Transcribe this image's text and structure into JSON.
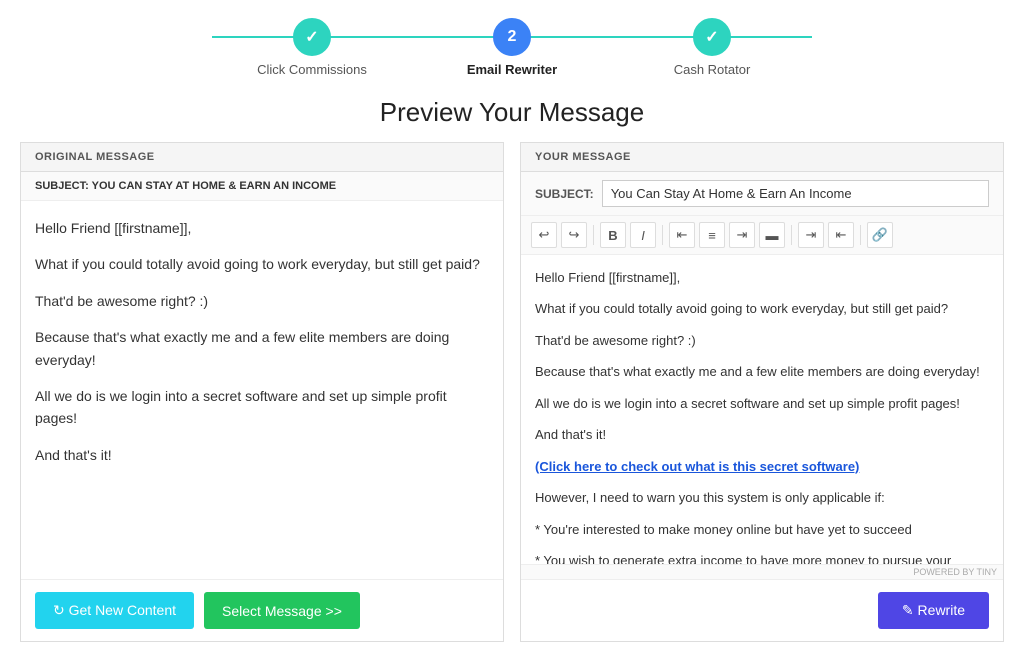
{
  "stepper": {
    "steps": [
      {
        "id": "click-commissions",
        "label": "Click Commissions",
        "state": "done",
        "icon": "✓",
        "number": ""
      },
      {
        "id": "email-rewriter",
        "label": "Email Rewriter",
        "state": "active",
        "icon": "",
        "number": "2"
      },
      {
        "id": "cash-rotator",
        "label": "Cash Rotator",
        "state": "done",
        "icon": "✓",
        "number": ""
      }
    ]
  },
  "page": {
    "title": "Preview Your Message"
  },
  "original_panel": {
    "header": "ORIGINAL MESSAGE",
    "subject_label": "SUBJECT: YOU CAN STAY AT HOME & EARN AN INCOME",
    "body_paragraphs": [
      "Hello Friend [[firstname]],",
      "What if you could totally avoid going to work everyday, but still get paid?",
      "That'd be awesome right? :)",
      "Because that's what exactly me and a few elite members are doing everyday!",
      "All we do is we login into a secret software and set up simple profit pages!",
      "And that's it!"
    ]
  },
  "your_panel": {
    "header": "YOUR MESSAGE",
    "subject_field_label": "SUBJECT:",
    "subject_value": "You Can Stay At Home & Earn An Income",
    "body_paragraphs": [
      "Hello Friend [[firstname]],",
      "What if you could totally avoid going to work everyday, but still get paid?",
      "That'd be awesome right? :)",
      "Because that's what exactly me and a few elite members are doing everyday!",
      "All we do is we login into a secret software and set up simple profit pages!",
      "And that's it!"
    ],
    "link_text": "(Click here to check out what is this secret software)",
    "extra_paragraphs": [
      "However, I need to warn you this system is only applicable if:",
      "* You're interested to make money online but have yet to succeed",
      "* You wish to generate extra income to have more money to pursue your passions."
    ],
    "powered_by": "POWERED BY TINY"
  },
  "buttons": {
    "get_new_content": "↻ Get New Content",
    "select_message": "Select Message >>",
    "rewrite": "✎ Rewrite"
  },
  "toolbar": {
    "undo": "↩",
    "redo": "↪",
    "bold": "B",
    "italic": "I",
    "align_left": "≡",
    "align_center": "≡",
    "align_right": "≡",
    "align_justify": "≡",
    "indent": "⇥",
    "outdent": "⇤",
    "link": "🔗"
  },
  "colors": {
    "cyan": "#22d3ee",
    "green": "#22c55e",
    "teal": "#2dd4bf",
    "blue": "#3b82f6",
    "purple": "#4f46e5",
    "link": "#1a56db"
  }
}
